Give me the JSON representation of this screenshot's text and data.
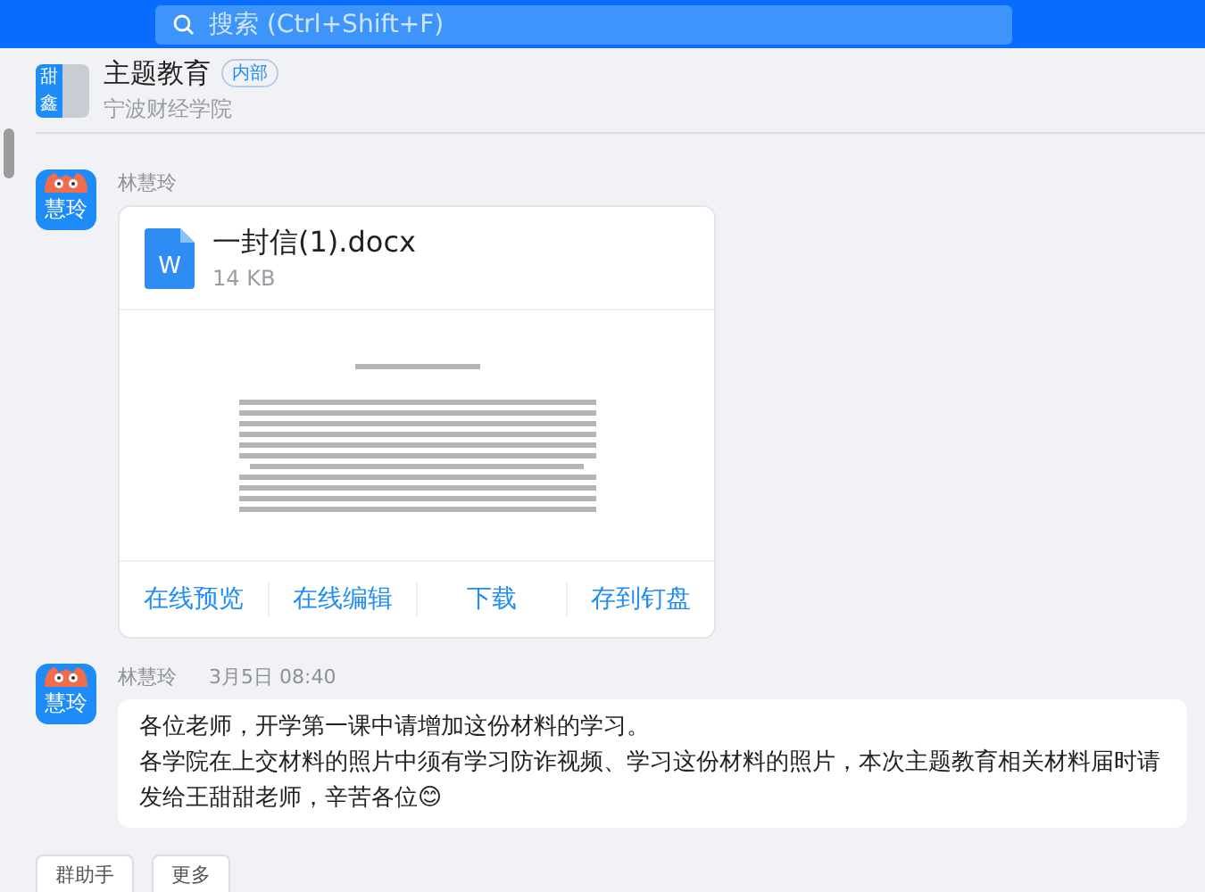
{
  "top_bar": {
    "search": {
      "placeholder": "搜索 (Ctrl+Shift+F)"
    }
  },
  "chat_header": {
    "avatar_tiles": [
      "甜",
      "鑫"
    ],
    "title": "主题教育",
    "badge": "内部",
    "subtitle": "宁波财经学院"
  },
  "messages": [
    {
      "kind": "file",
      "sender": "林慧玲",
      "avatar_text": "慧玲",
      "file": {
        "name": "一封信(1).docx",
        "size": "14 KB",
        "type_icon": "W"
      },
      "actions": [
        "在线预览",
        "在线编辑",
        "下载",
        "存到钉盘"
      ]
    },
    {
      "kind": "text",
      "sender": "林慧玲",
      "avatar_text": "慧玲",
      "time": "3月5日 08:40",
      "lines": [
        "各位老师，开学第一课中请增加这份材料的学习。",
        "各学院在上交材料的照片中须有学习防诈视频、学习这份材料的照片，本次主题教育相关材料届时请发给王甜甜老师，辛苦各位😊"
      ]
    }
  ],
  "toolbar": [
    "群助手",
    "更多"
  ]
}
